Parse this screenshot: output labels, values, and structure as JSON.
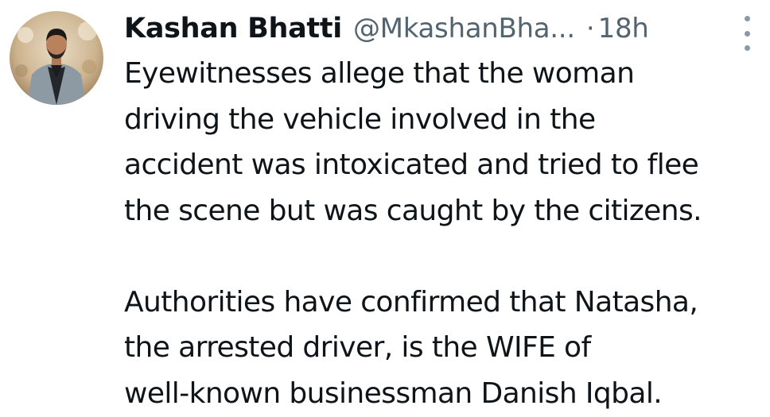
{
  "tweet": {
    "author": {
      "display_name": "Kashan Bhatti",
      "handle": "@MkashanBha...",
      "avatar_icon": "profile-photo"
    },
    "separator": "·",
    "timestamp": "18h",
    "more_icon": "more-vertical-icon",
    "paragraphs": [
      [
        "Eyewitnesses allege that the woman",
        "driving the vehicle involved in the",
        "accident was intoxicated and tried to flee",
        "the scene but was caught by the citizens."
      ],
      [
        "Authorities have confirmed that Natasha,",
        "the arrested driver, is the WIFE of",
        "well-known businessman Danish Iqbal."
      ]
    ]
  },
  "colors": {
    "text_primary": "#0f1419",
    "text_secondary": "#536471",
    "background": "#ffffff"
  }
}
